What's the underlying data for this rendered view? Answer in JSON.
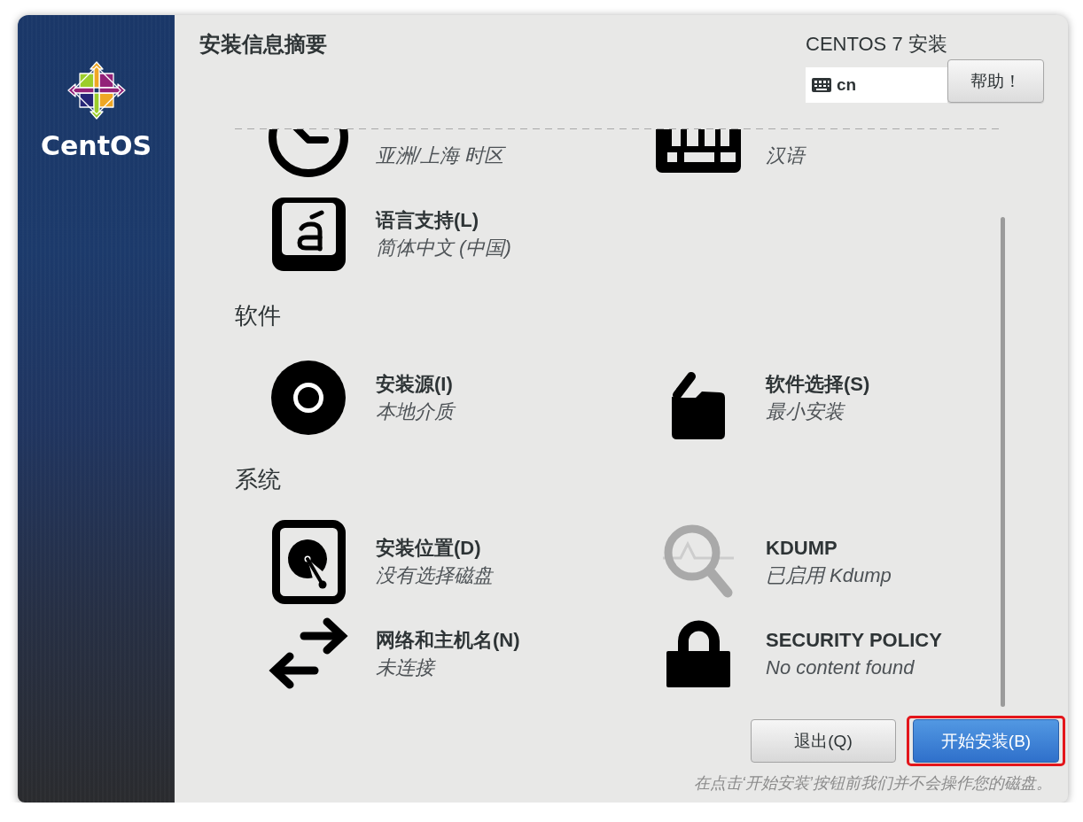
{
  "sidebar": {
    "logo_text": "CentOS"
  },
  "header": {
    "title": "安装信息摘要",
    "product": "CENTOS 7 安装",
    "keyboard_layout": "cn",
    "help_button": "帮助！"
  },
  "sections": [
    {
      "items": [
        {
          "status": "亚洲/上海 时区"
        },
        {
          "status": "汉语"
        },
        {
          "title": "语言支持(L)",
          "status": "简体中文 (中国)"
        }
      ]
    },
    {
      "heading": "软件",
      "items": [
        {
          "title": "安装源(I)",
          "status": "本地介质"
        },
        {
          "title": "软件选择(S)",
          "status": "最小安装"
        }
      ]
    },
    {
      "heading": "系统",
      "items": [
        {
          "title": "安装位置(D)",
          "status": "没有选择磁盘"
        },
        {
          "title": "KDUMP",
          "status": "已启用 Kdump"
        },
        {
          "title": "网络和主机名(N)",
          "status": "未连接"
        },
        {
          "title": "SECURITY POLICY",
          "status": "No content found"
        }
      ]
    }
  ],
  "buttons": [
    {
      "label": "退出(Q)",
      "kind": "secondary",
      "highlighted": false
    },
    {
      "label": "开始安装(B)",
      "kind": "primary",
      "highlighted": true
    }
  ],
  "footer_note": "在点击‘开始安装’按钮前我们并不会操作您的磁盘。"
}
